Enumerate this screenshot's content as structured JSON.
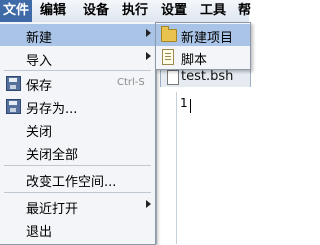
{
  "menubar": {
    "items": [
      "文件",
      "编辑",
      "设备",
      "执行",
      "设置",
      "工具",
      "帮"
    ]
  },
  "file_menu": {
    "new_label": "新建",
    "import_label": "导入",
    "save_label": "保存",
    "save_shortcut": "Ctrl-S",
    "save_as_label": "另存为...",
    "close_label": "关闭",
    "close_all_label": "关闭全部",
    "change_workspace_label": "改变工作空间...",
    "recent_label": "最近打开",
    "exit_label": "退出"
  },
  "new_submenu": {
    "new_project_label": "新建项目",
    "script_label": "脚本"
  },
  "editor": {
    "tab_name": "test.bsh",
    "line_number": "1"
  }
}
